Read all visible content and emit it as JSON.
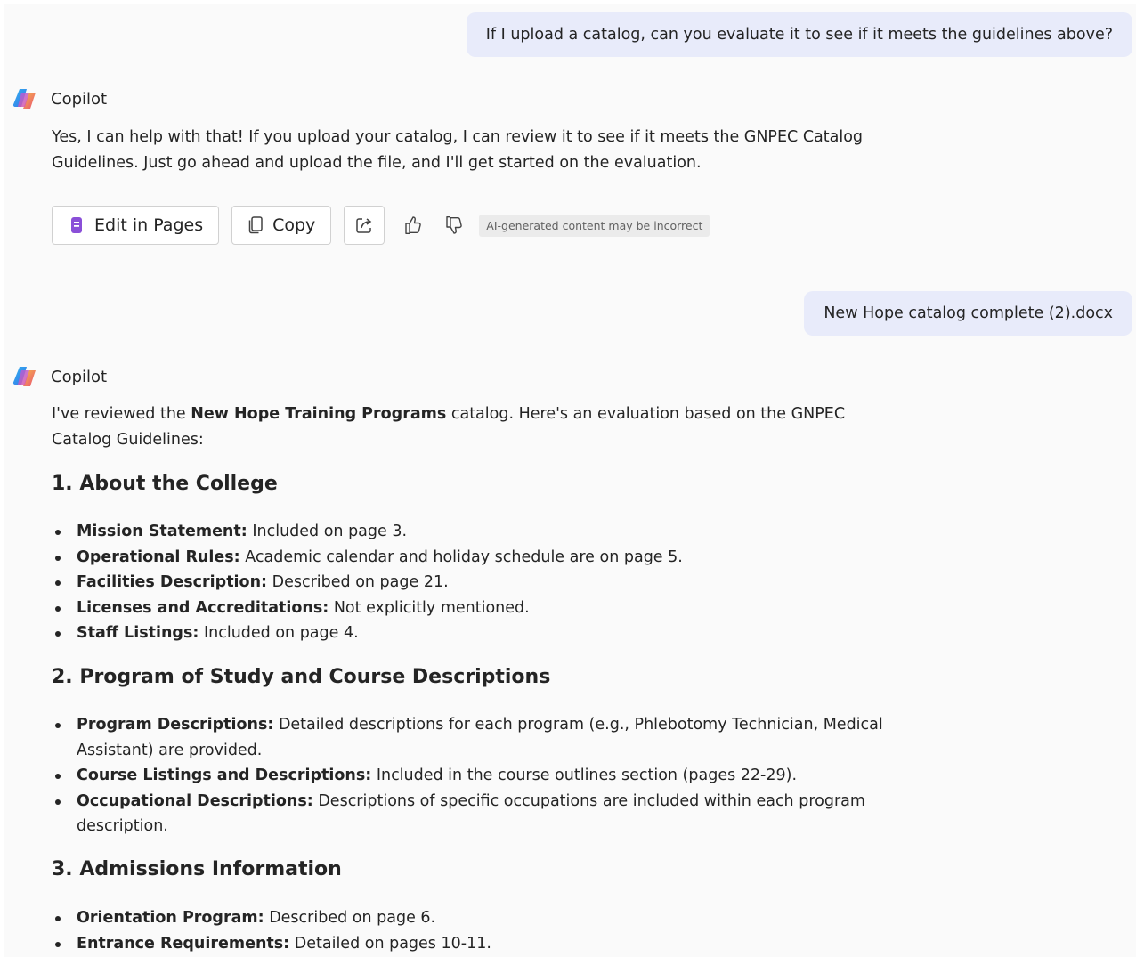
{
  "messages": {
    "user_1": "If I upload a catalog, can you evaluate it to see if it meets the guidelines above?",
    "bot_name": "Copilot",
    "bot_1": "Yes, I can help with that! If you upload your catalog, I can review it to see if it meets the GNPEC Catalog Guidelines. Just go ahead and upload the file, and I'll get started on the evaluation.",
    "user_2_file": "New Hope catalog complete (2).docx",
    "bot_2_intro_pre": "I've reviewed the ",
    "bot_2_intro_bold": "New Hope Training Programs",
    "bot_2_intro_post": " catalog. Here's an evaluation based on the GNPEC Catalog Guidelines:"
  },
  "actions": {
    "edit_label": "Edit in Pages",
    "copy_label": "Copy",
    "disclaimer": "AI-generated content may be incorrect"
  },
  "sections": [
    {
      "title": "1. About the College",
      "items": [
        {
          "key": "Mission Statement:",
          "text": " Included on page 3."
        },
        {
          "key": "Operational Rules:",
          "text": " Academic calendar and holiday schedule are on page 5."
        },
        {
          "key": "Facilities Description:",
          "text": " Described on page 21."
        },
        {
          "key": "Licenses and Accreditations:",
          "text": " Not explicitly mentioned."
        },
        {
          "key": "Staff Listings:",
          "text": " Included on page 4."
        }
      ]
    },
    {
      "title": "2. Program of Study and Course Descriptions",
      "items": [
        {
          "key": "Program Descriptions:",
          "text": " Detailed descriptions for each program (e.g., Phlebotomy Technician, Medical Assistant) are provided."
        },
        {
          "key": "Course Listings and Descriptions:",
          "text": " Included in the course outlines section (pages 22-29)."
        },
        {
          "key": "Occupational Descriptions:",
          "text": " Descriptions of specific occupations are included within each program description."
        }
      ]
    },
    {
      "title": "3. Admissions Information",
      "items": [
        {
          "key": "Orientation Program:",
          "text": " Described on page 6."
        },
        {
          "key": "Entrance Requirements:",
          "text": " Detailed on pages 10-11."
        }
      ]
    }
  ],
  "colors": {
    "user_bubble": "#e8ebfa",
    "pages_icon": "#8a4fd8"
  }
}
